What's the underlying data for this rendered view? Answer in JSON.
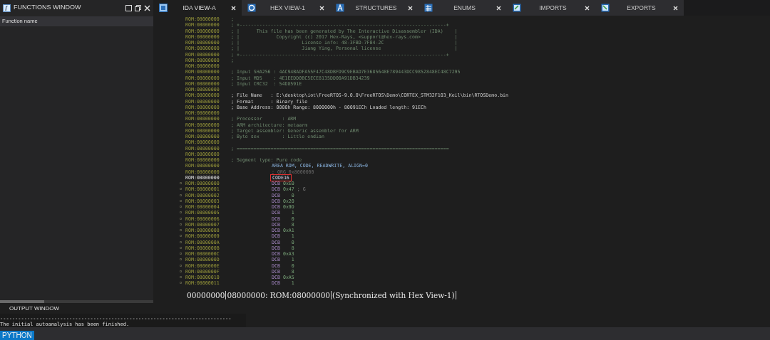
{
  "functions_window": {
    "title": "FUNCTIONS WINDOW",
    "column": "Function name"
  },
  "tabs": [
    {
      "label": "IDA VIEW-A",
      "selected": true
    },
    {
      "label": "HEX VIEW-1",
      "selected": false
    },
    {
      "label": "STRUCTURES",
      "selected": false
    },
    {
      "label": "ENUMS",
      "selected": false
    },
    {
      "label": "IMPORTS",
      "selected": false
    },
    {
      "label": "EXPORTS",
      "selected": false
    }
  ],
  "listing": [
    {
      "address": "ROM:08000000",
      "kind": "comment",
      "text": ";",
      "current": false
    },
    {
      "address": "ROM:08000000",
      "kind": "comment",
      "text": "; +-------------------------------------------------------------------------+",
      "current": false
    },
    {
      "address": "ROM:08000000",
      "kind": "comment",
      "text": "; |      This file has been generated by The Interactive Disassembler (IDA)    |",
      "current": false
    },
    {
      "address": "ROM:08000000",
      "kind": "comment",
      "text": "; |             Copyright (c) 2017 Hex-Rays, <support@hex-rays.com>            |",
      "current": false
    },
    {
      "address": "ROM:08000000",
      "kind": "comment",
      "text": "; |                      License info: 48-3FBD-7F04-2C                         |",
      "current": false
    },
    {
      "address": "ROM:08000000",
      "kind": "comment",
      "text": "; |                      Jiang Ying, Personal license                          |",
      "current": false
    },
    {
      "address": "ROM:08000000",
      "kind": "comment",
      "text": "; +-------------------------------------------------------------------------+",
      "current": false
    },
    {
      "address": "ROM:08000000",
      "kind": "comment",
      "text": ";",
      "current": false
    },
    {
      "address": "ROM:08000000",
      "kind": "blank",
      "current": false
    },
    {
      "address": "ROM:08000000",
      "kind": "comment",
      "text": "; Input SHA256 : 4AC94BADFA55F47C48DBFD9C9EBAD7E3685648E789443DCC9852848EC48C7295",
      "current": false
    },
    {
      "address": "ROM:08000000",
      "kind": "comment",
      "text": "; Input MD5    : 4E1EEDD0BC5ECE8135DD00A91DB34239",
      "current": false
    },
    {
      "address": "ROM:08000000",
      "kind": "comment",
      "text": "; Input CRC32  : 54D8591E",
      "current": false
    },
    {
      "address": "ROM:08000000",
      "kind": "blank",
      "current": false
    },
    {
      "address": "ROM:08000000",
      "kind": "info",
      "text": "; File Name   : E:\\desktop\\iot\\FreeRTOS-9.0.0\\FreeRTOS\\Demo\\CORTEX_STM32F103_Keil\\bin\\RTOSDemo.bin",
      "current": false
    },
    {
      "address": "ROM:08000000",
      "kind": "info",
      "text": "; Format      : Binary file",
      "current": false
    },
    {
      "address": "ROM:08000000",
      "kind": "info",
      "text": "; Base Address: 0000h Range: 8000000h - 80091ECh Loaded length: 91ECh",
      "current": false
    },
    {
      "address": "ROM:08000000",
      "kind": "blank",
      "current": false
    },
    {
      "address": "ROM:08000000",
      "kind": "comment",
      "text": "; Processor       : ARM",
      "current": false
    },
    {
      "address": "ROM:08000000",
      "kind": "comment",
      "text": "; ARM architecture: metaarm",
      "current": false
    },
    {
      "address": "ROM:08000000",
      "kind": "comment",
      "text": "; Target assembler: Generic assembler for ARM",
      "current": false
    },
    {
      "address": "ROM:08000000",
      "kind": "comment",
      "text": "; Byte sex        : Little endian",
      "current": false
    },
    {
      "address": "ROM:08000000",
      "kind": "blank",
      "current": false
    },
    {
      "address": "ROM:08000000",
      "kind": "comment",
      "text": "; ===========================================================================",
      "current": false
    },
    {
      "address": "ROM:08000000",
      "kind": "blank",
      "current": false
    },
    {
      "address": "ROM:08000000",
      "kind": "comment",
      "text": "; Segment type: Pure code",
      "current": false
    },
    {
      "address": "ROM:08000000",
      "kind": "directive",
      "text": "AREA ROM, CODE, READWRITE, ALIGN=0",
      "current": false
    },
    {
      "address": "ROM:08000000",
      "kind": "directive_comment",
      "text": "; ORG 0x8000000",
      "current": false
    },
    {
      "address": "ROM:08000000",
      "kind": "label",
      "text": "CODE16",
      "current": true
    },
    {
      "address": "ROM:08000000",
      "kind": "data",
      "mnemonic": "DCB",
      "operand": "0xE0",
      "current": false
    },
    {
      "address": "ROM:08000001",
      "kind": "data",
      "mnemonic": "DCB",
      "operand": "0x47",
      "comment": "; G",
      "current": false
    },
    {
      "address": "ROM:08000002",
      "kind": "data",
      "mnemonic": "DCB",
      "operand": "   0",
      "current": false
    },
    {
      "address": "ROM:08000003",
      "kind": "data",
      "mnemonic": "DCB",
      "operand": "0x20",
      "current": false
    },
    {
      "address": "ROM:08000004",
      "kind": "data",
      "mnemonic": "DCB",
      "operand": "0x9D",
      "current": false
    },
    {
      "address": "ROM:08000005",
      "kind": "data",
      "mnemonic": "DCB",
      "operand": "   1",
      "current": false
    },
    {
      "address": "ROM:08000006",
      "kind": "data",
      "mnemonic": "DCB",
      "operand": "   0",
      "current": false
    },
    {
      "address": "ROM:08000007",
      "kind": "data",
      "mnemonic": "DCB",
      "operand": "   8",
      "current": false
    },
    {
      "address": "ROM:08000008",
      "kind": "data",
      "mnemonic": "DCB",
      "operand": "0xA1",
      "current": false
    },
    {
      "address": "ROM:08000009",
      "kind": "data",
      "mnemonic": "DCB",
      "operand": "   1",
      "current": false
    },
    {
      "address": "ROM:0800000A",
      "kind": "data",
      "mnemonic": "DCB",
      "operand": "   0",
      "current": false
    },
    {
      "address": "ROM:0800000B",
      "kind": "data",
      "mnemonic": "DCB",
      "operand": "   8",
      "current": false
    },
    {
      "address": "ROM:0800000C",
      "kind": "data",
      "mnemonic": "DCB",
      "operand": "0xA3",
      "current": false
    },
    {
      "address": "ROM:0800000D",
      "kind": "data",
      "mnemonic": "DCB",
      "operand": "   1",
      "current": false
    },
    {
      "address": "ROM:0800000E",
      "kind": "data",
      "mnemonic": "DCB",
      "operand": "   0",
      "current": false
    },
    {
      "address": "ROM:0800000F",
      "kind": "data",
      "mnemonic": "DCB",
      "operand": "   8",
      "current": false
    },
    {
      "address": "ROM:08000010",
      "kind": "data",
      "mnemonic": "DCB",
      "operand": "0xA5",
      "current": false
    },
    {
      "address": "ROM:08000011",
      "kind": "data",
      "mnemonic": "DCB",
      "operand": "   1",
      "current": false
    }
  ],
  "status_line": [
    "00000000",
    "08000000: ROM:08000000",
    "(Synchronized with Hex View-1)"
  ],
  "output_window": {
    "title": "OUTPUT WINDOW",
    "separator": "-----------------------------------------------------------------------------",
    "message": "The initial autoanalysis has been finished."
  },
  "python_tab": "PYTHON"
}
